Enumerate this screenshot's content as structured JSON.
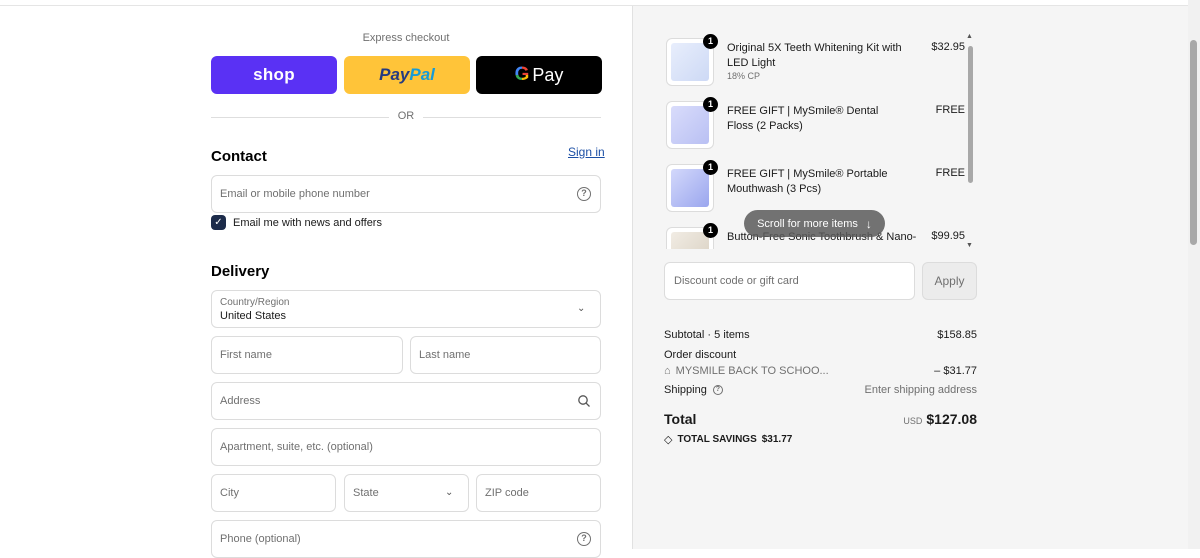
{
  "express": {
    "label": "Express checkout",
    "shop_label": "shop",
    "paypal_pay": "Pay",
    "paypal_pal": "Pal",
    "gpay_g": "G",
    "gpay_label": "Pay",
    "or_label": "OR"
  },
  "contact": {
    "title": "Contact",
    "signin": "Sign in",
    "email_placeholder": "Email or mobile phone number",
    "news_checkbox_label": "Email me with news and offers",
    "news_checked": true
  },
  "delivery": {
    "title": "Delivery",
    "country_label": "Country/Region",
    "country_value": "United States",
    "first_name": "First name",
    "last_name": "Last name",
    "address": "Address",
    "apartment": "Apartment, suite, etc. (optional)",
    "city": "City",
    "state": "State",
    "zip": "ZIP code",
    "phone": "Phone (optional)"
  },
  "order": {
    "items": [
      {
        "name": "Original 5X Teeth Whitening Kit with LED Light",
        "sub": "18% CP",
        "price": "$32.95",
        "qty": "1"
      },
      {
        "name": "FREE GIFT | MySmile® Dental Floss (2 Packs)",
        "sub": "",
        "price": "FREE",
        "qty": "1"
      },
      {
        "name": "FREE GIFT | MySmile® Portable Mouthwash (3 Pcs)",
        "sub": "",
        "price": "FREE",
        "qty": "1"
      },
      {
        "name": "Button-Free Sonic Toothbrush & Nano-",
        "sub": "",
        "price": "$99.95",
        "qty": "1"
      }
    ],
    "scroll_more": "Scroll for more items",
    "discount_placeholder": "Discount code or gift card",
    "apply": "Apply",
    "subtotal_label": "Subtotal · 5 items",
    "subtotal_value": "$158.85",
    "order_discount_label": "Order discount",
    "discount_code": "MYSMILE BACK TO SCHOO...",
    "discount_value": "– $31.77",
    "shipping_label": "Shipping",
    "shipping_value": "Enter shipping address",
    "total_label": "Total",
    "currency": "USD",
    "total_value": "$127.08",
    "savings_label": "TOTAL SAVINGS",
    "savings_value": "$31.77"
  },
  "colors": {
    "shop": "#5a31f4",
    "paypal": "#ffc439",
    "gpay": "#000000",
    "link": "#1c4fa5"
  }
}
